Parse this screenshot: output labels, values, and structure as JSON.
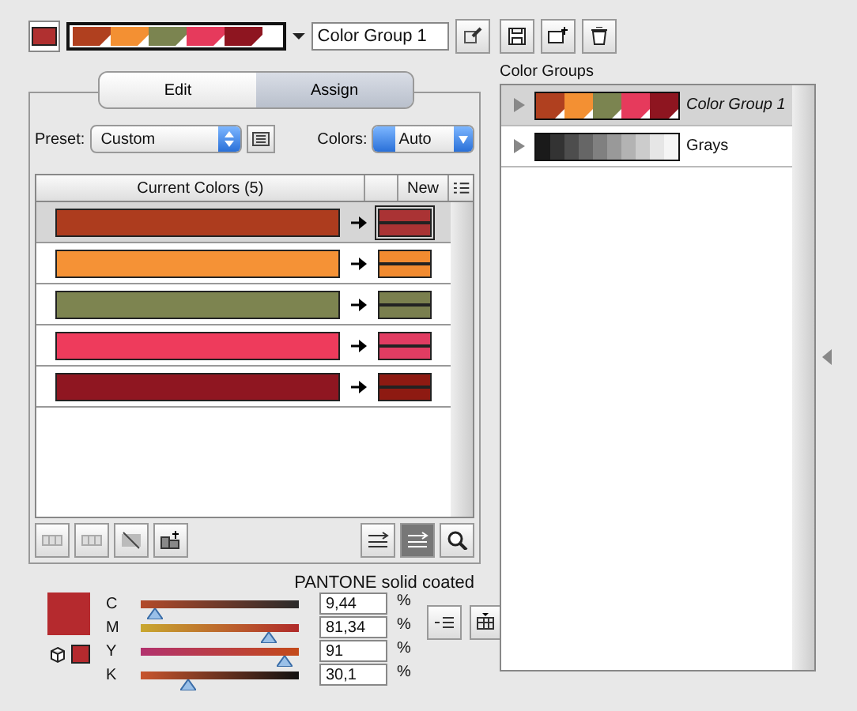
{
  "toolbar": {
    "current": {
      "color": "#b03030"
    },
    "group_swatches": [
      {
        "color": "#b0401f"
      },
      {
        "color": "#f39033"
      },
      {
        "color": "#7b8450"
      },
      {
        "color": "#e63a5c"
      },
      {
        "color": "#8e1520"
      }
    ],
    "group_name": "Color Group 1"
  },
  "tabs": [
    {
      "label": "Edit",
      "selected": false
    },
    {
      "label": "Assign",
      "selected": true
    }
  ],
  "preset": {
    "label": "Preset:",
    "value": "Custom"
  },
  "colors": {
    "label": "Colors:",
    "value": "Auto"
  },
  "table": {
    "columns": [
      "Current Colors (5)",
      "New"
    ],
    "rows": [
      {
        "current": {
          "color": "#ad3c1e"
        },
        "new": {
          "color": "#aa3334"
        },
        "selected": true
      },
      {
        "current": {
          "color": "#f59236"
        },
        "new": {
          "color": "#f28b30"
        },
        "selected": false
      },
      {
        "current": {
          "color": "#7d8450"
        },
        "new": {
          "color": "#7a7f4e"
        },
        "selected": false
      },
      {
        "current": {
          "color": "#ee3b5c"
        },
        "new": {
          "color": "#e13c62"
        },
        "selected": false
      },
      {
        "current": {
          "color": "#8f1621"
        },
        "new": {
          "color": "#8e1a12"
        },
        "selected": false
      }
    ]
  },
  "library": "PANTONE solid coated",
  "sliders": [
    {
      "label": "C",
      "level": 0.09,
      "value": "9,44",
      "unit": "%"
    },
    {
      "label": "M",
      "level": 0.81,
      "value": "81,34",
      "unit": "%"
    },
    {
      "label": "Y",
      "level": 0.91,
      "value": "91",
      "unit": "%"
    },
    {
      "label": "K",
      "level": 0.3,
      "value": "30,1",
      "unit": "%"
    }
  ],
  "swatch": {
    "color": "#b52a2e"
  },
  "color_groups": {
    "title": "Color Groups",
    "items": [
      {
        "name": "Color Group 1",
        "selected": true,
        "swatches": [
          {
            "color": "#b0401f"
          },
          {
            "color": "#f39033"
          },
          {
            "color": "#7b8450"
          },
          {
            "color": "#e63a5c"
          },
          {
            "color": "#8e1520"
          }
        ]
      },
      {
        "name": "Grays",
        "selected": false,
        "swatches": [
          {
            "color": "#1a1a1a"
          },
          {
            "color": "#333333"
          },
          {
            "color": "#4d4d4d"
          },
          {
            "color": "#666666"
          },
          {
            "color": "#808080"
          },
          {
            "color": "#999999"
          },
          {
            "color": "#b3b3b3"
          },
          {
            "color": "#cccccc"
          },
          {
            "color": "#e6e6e6"
          },
          {
            "color": "#f5f5f5"
          }
        ]
      }
    ]
  }
}
